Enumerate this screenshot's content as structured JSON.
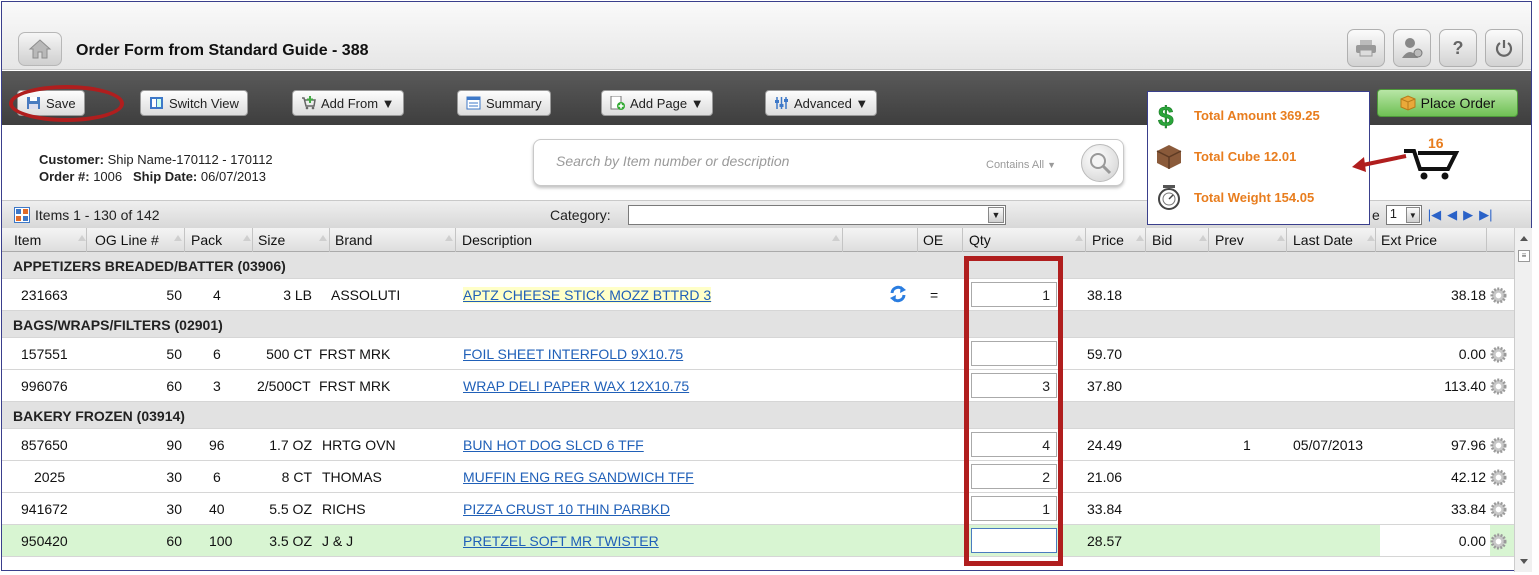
{
  "header": {
    "title": "Order Form from Standard Guide - 388",
    "icons": [
      "home-icon",
      "printer-icon",
      "user-settings-icon",
      "help-icon",
      "power-icon"
    ],
    "help_label": "?"
  },
  "toolbar": {
    "save_label": "Save",
    "switch_view_label": "Switch View",
    "add_from_label": "Add From ▼",
    "summary_label": "Summary",
    "add_page_label": "Add Page ▼",
    "advanced_label": "Advanced ▼",
    "place_order_label": "Place Order"
  },
  "info": {
    "customer_label": "Customer:",
    "customer_value": "Ship Name-170112 - 170112",
    "order_label": "Order #:",
    "order_value": "1006",
    "ship_label": "Ship Date:",
    "ship_value": "06/07/2013"
  },
  "search": {
    "placeholder": "Search by Item number or description",
    "mode": "Contains All"
  },
  "totals": {
    "amount_label": "Total Amount",
    "amount_value": "369.25",
    "cube_label": "Total Cube",
    "cube_value": "12.01",
    "weight_label": "Total Weight",
    "weight_value": "154.05",
    "cart_count": "16",
    "accent_color": "#e87d1e"
  },
  "grid": {
    "items_count": "Items 1 - 130 of 142",
    "category_label": "Category:",
    "category_value": "",
    "page_value": "1",
    "page_suffix": "e",
    "columns": [
      "Item",
      "OG Line #",
      "Pack",
      "Size",
      "Brand",
      "Description",
      "OE",
      "Qty",
      "Price",
      "Bid",
      "Prev",
      "Last Date",
      "Ext Price"
    ],
    "groups": [
      {
        "name": "APPETIZERS BREADED/BATTER (03906)",
        "rows": [
          {
            "item": "231663",
            "og": "50",
            "pack": "4",
            "size": "3 LB",
            "brand": "ASSOLUTI",
            "desc": "APTZ CHEESE STICK MOZZ BTTRD 3",
            "oe": "=",
            "qty": "1",
            "price": "38.18",
            "bid": "",
            "prev": "",
            "last": "",
            "ext": "38.18"
          }
        ]
      },
      {
        "name": "BAGS/WRAPS/FILTERS (02901)",
        "rows": [
          {
            "item": "157551",
            "og": "50",
            "pack": "6",
            "size": "500 CT",
            "brand": "FRST MRK",
            "desc": "FOIL SHEET INTERFOLD 9X10.75",
            "oe": "",
            "qty": "",
            "price": "59.70",
            "bid": "",
            "prev": "",
            "last": "",
            "ext": "0.00"
          },
          {
            "item": "996076",
            "og": "60",
            "pack": "3",
            "size": "2/500CT",
            "brand": "FRST MRK",
            "desc": "WRAP DELI PAPER WAX 12X10.75",
            "oe": "",
            "qty": "3",
            "price": "37.80",
            "bid": "",
            "prev": "",
            "last": "",
            "ext": "113.40"
          }
        ]
      },
      {
        "name": "BAKERY FROZEN (03914)",
        "rows": [
          {
            "item": "857650",
            "og": "90",
            "pack": "96",
            "size": "1.7 OZ",
            "brand": "HRTG OVN",
            "desc": "BUN HOT DOG SLCD 6 TFF",
            "oe": "",
            "qty": "4",
            "price": "24.49",
            "bid": "",
            "prev": "1",
            "last": "05/07/2013",
            "ext": "97.96"
          },
          {
            "item": "2025",
            "og": "30",
            "pack": "6",
            "size": "8 CT",
            "brand": "THOMAS",
            "desc": "MUFFIN ENG REG SANDWICH TFF",
            "oe": "",
            "qty": "2",
            "price": "21.06",
            "bid": "",
            "prev": "",
            "last": "",
            "ext": "42.12"
          },
          {
            "item": "941672",
            "og": "30",
            "pack": "40",
            "size": "5.5 OZ",
            "brand": "RICHS",
            "desc": "PIZZA CRUST 10 THIN PARBKD",
            "oe": "",
            "qty": "1",
            "price": "33.84",
            "bid": "",
            "prev": "",
            "last": "",
            "ext": "33.84"
          },
          {
            "item": "950420",
            "og": "60",
            "pack": "100",
            "size": "3.5 OZ",
            "brand": "J & J",
            "desc": "PRETZEL SOFT MR TWISTER",
            "oe": "",
            "qty": "",
            "price": "28.57",
            "bid": "",
            "prev": "",
            "last": "",
            "ext": "0.00"
          }
        ]
      }
    ]
  },
  "colors": {
    "highlight_red": "#b01e1e",
    "link_blue": "#2060b8",
    "selected_row": "#d8f5d2",
    "place_order_green": "#6fc054"
  }
}
